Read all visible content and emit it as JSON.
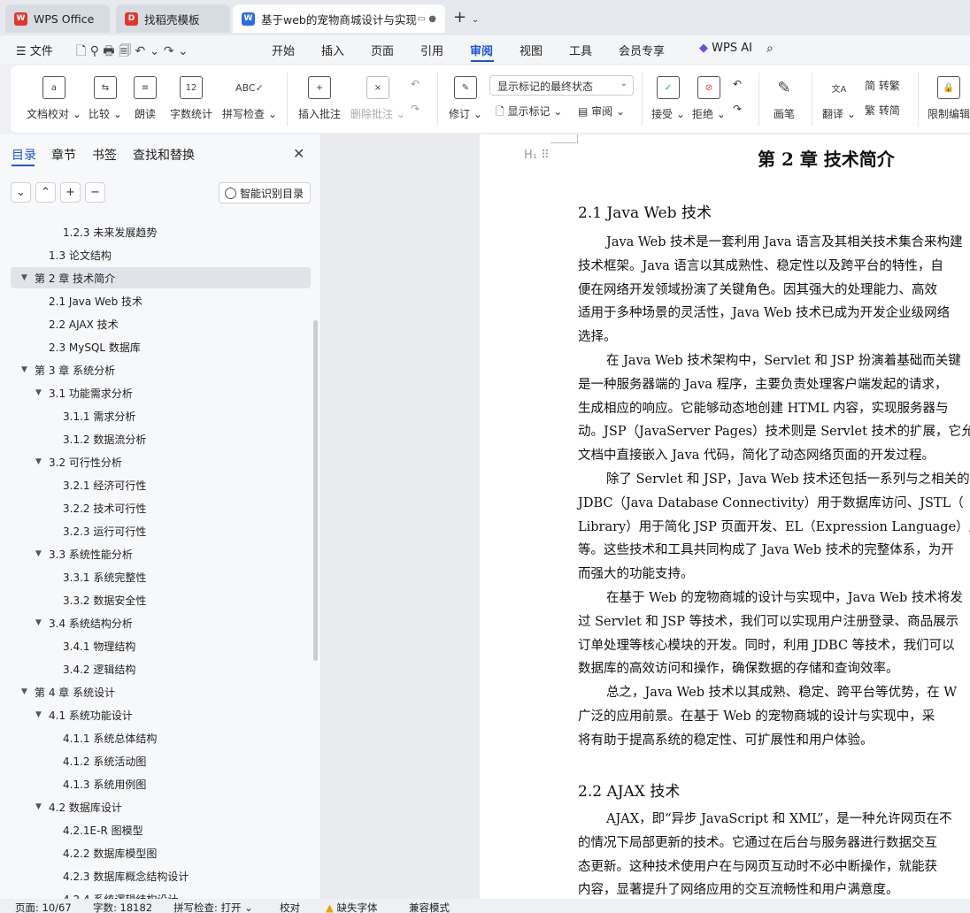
{
  "tabs": [
    {
      "label": "WPS Office",
      "icon": "wps-logo-icon",
      "color": "#e0362e"
    },
    {
      "label": "找稻壳模板",
      "icon": "docer-icon",
      "color": "#e0362e"
    },
    {
      "label": "基于web的宠物商城设计与实现",
      "icon": "writer-doc-icon",
      "color": "#2f6de1"
    }
  ],
  "menu": {
    "file": "文件",
    "items": [
      "开始",
      "插入",
      "页面",
      "引用",
      "审阅",
      "视图",
      "工具",
      "会员专享"
    ],
    "active": "审阅",
    "wps_ai": "WPS AI"
  },
  "ribbon": {
    "doc_proof": "文档校对",
    "compare": "比较",
    "read_aloud": "朗读",
    "word_count": "字数统计",
    "spell_check": "拼写检查",
    "insert_comment": "插入批注",
    "delete_comment": "删除批注",
    "revise": "修订",
    "markup_select": "显示标记的最终状态",
    "show_markup": "显示标记",
    "review": "审阅",
    "accept": "接受",
    "reject": "拒绝",
    "ink": "画笔",
    "translate": "翻译",
    "to_traditional": "简 转繁",
    "to_simplified": "繁 转简",
    "restrict_edit": "限制编辑"
  },
  "sidebar": {
    "tabs": [
      "目录",
      "章节",
      "书签",
      "查找和替换"
    ],
    "smart_toc": "智能识别目录",
    "toc": [
      {
        "label": "1.2.3  未来发展趋势",
        "level": 3
      },
      {
        "label": "1.3 论文结构",
        "level": 2
      },
      {
        "label": "第 2 章  技术简介",
        "level": 1,
        "expanded": true,
        "selected": true
      },
      {
        "label": "2.1 Java Web 技术",
        "level": 2
      },
      {
        "label": "2.2 AJAX 技术",
        "level": 2
      },
      {
        "label": "2.3 MySQL 数据库",
        "level": 2
      },
      {
        "label": "第 3 章  系统分析",
        "level": 1,
        "expanded": true
      },
      {
        "label": "3.1 功能需求分析",
        "level": 2,
        "expanded": true
      },
      {
        "label": "3.1.1 需求分析",
        "level": 3
      },
      {
        "label": "3.1.2 数据流分析",
        "level": 3
      },
      {
        "label": "3.2 可行性分析",
        "level": 2,
        "expanded": true
      },
      {
        "label": "3.2.1 经济可行性",
        "level": 3
      },
      {
        "label": "3.2.2 技术可行性",
        "level": 3
      },
      {
        "label": "3.2.3  运行可行性",
        "level": 3
      },
      {
        "label": "3.3  系统性能分析",
        "level": 2,
        "expanded": true
      },
      {
        "label": "3.3.1 系统完整性",
        "level": 3
      },
      {
        "label": "3.3.2 数据安全性",
        "level": 3
      },
      {
        "label": "3.4 系统结构分析",
        "level": 2,
        "expanded": true
      },
      {
        "label": "3.4.1 物理结构",
        "level": 3
      },
      {
        "label": "3.4.2 逻辑结构",
        "level": 3
      },
      {
        "label": "第 4 章  系统设计",
        "level": 1,
        "expanded": true
      },
      {
        "label": "4.1  系统功能设计",
        "level": 2,
        "expanded": true
      },
      {
        "label": "4.1.1 系统总体结构",
        "level": 3
      },
      {
        "label": "4.1.2 系统活动图",
        "level": 3
      },
      {
        "label": "4.1.3 系统用例图",
        "level": 3
      },
      {
        "label": "4.2 数据库设计",
        "level": 2,
        "expanded": true
      },
      {
        "label": "4.2.1E-R 图模型",
        "level": 3
      },
      {
        "label": "4.2.2 数据库模型图",
        "level": 3
      },
      {
        "label": "4.2.3 数据库概念结构设计",
        "level": 3
      },
      {
        "label": "4.2.4 系统逻辑结构设计",
        "level": 3
      }
    ]
  },
  "document": {
    "chapter_title": "第 2 章  技术简介",
    "section_21": "2.1 Java Web 技术",
    "p21_lines": [
      "Java Web 技术是一套利用 Java 语言及其相关技术集合来构建",
      "技术框架。Java 语言以其成熟性、稳定性以及跨平台的特性，自",
      "便在网络开发领域扮演了关键角色。因其强大的处理能力、高效",
      "适用于多种场景的灵活性，Java Web 技术已成为开发企业级网络",
      "选择。",
      "在 Java Web 技术架构中，Servlet 和 JSP 扮演着基础而关键",
      "是一种服务器端的 Java 程序，主要负责处理客户端发起的请求，",
      "生成相应的响应。它能够动态地创建 HTML 内容，实现服务器与",
      "动。JSP（JavaServer Pages）技术则是 Servlet 技术的扩展，它允许",
      "文档中直接嵌入 Java 代码，简化了动态网络页面的开发过程。",
      "除了 Servlet 和 JSP，Java Web 技术还包括一系列与之相关的",
      "JDBC（Java Database Connectivity）用于数据库访问、JSTL（",
      "Library）用于简化 JSP 页面开发、EL（Expression Language）用",
      "等。这些技术和工具共同构成了 Java Web 技术的完整体系，为开",
      "而强大的功能支持。",
      "在基于 Web 的宠物商城的设计与实现中，Java Web 技术将发",
      "过 Servlet 和 JSP 等技术，我们可以实现用户注册登录、商品展示",
      "订单处理等核心模块的开发。同时，利用 JDBC 等技术，我们可以",
      "数据库的高效访问和操作，确保数据的存储和查询效率。",
      "总之，Java Web 技术以其成熟、稳定、跨平台等优势，在 W",
      "广泛的应用前景。在基于 Web 的宠物商城的设计与实现中，采",
      "将有助于提高系统的稳定性、可扩展性和用户体验。"
    ],
    "section_22": "2.2 AJAX 技术",
    "p22_lines": [
      "AJAX，即“异步 JavaScript 和 XML”，是一种允许网页在不",
      "的情况下局部更新的技术。它通过在后台与服务器进行数据交互",
      "态更新。这种技术使用户在与网页互动时不必中断操作，就能获",
      "内容，显著提升了网络应用的交互流畅性和用户满意度。"
    ]
  },
  "status": {
    "page": "页面: 10/67",
    "words": "字数: 18182",
    "spell": "拼写检查: 打开",
    "proof": "校对",
    "missing_font": "缺失字体",
    "compat": "兼容模式"
  }
}
